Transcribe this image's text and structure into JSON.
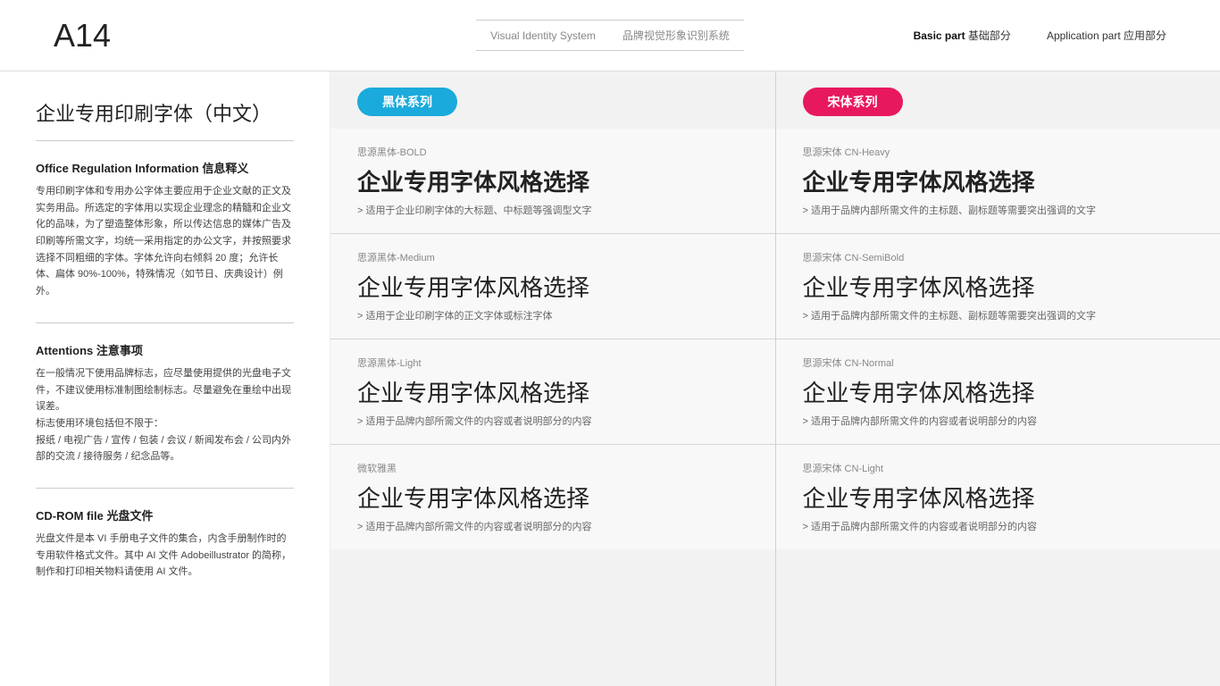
{
  "header": {
    "logo": "A14",
    "title_en": "Visual Identity System",
    "title_cn": "品牌视觉形象识别系统",
    "nav": [
      {
        "label": "Basic part",
        "label_cn": " 基础部分",
        "active": true
      },
      {
        "label": "Application part",
        "label_cn": "  应用部分",
        "active": false
      }
    ]
  },
  "sidebar": {
    "title": "企业专用印刷字体（中文）",
    "sections": [
      {
        "title": "Office Regulation Information 信息释义",
        "body": "专用印刷字体和专用办公字体主要应用于企业文献的正文及实务用品。所选定的字体用以实现企业理念的精髓和企业文化的品味，为了塑造整体形象，所以传达信息的媒体广告及印刷等所需文字，均统一采用指定的办公文字，并按照要求选择不同粗细的字体。字体允许向右倾斜 20 度；允许长体、扁体 90%-100%，特殊情况（如节日、庆典设计）例外。"
      },
      {
        "title": "Attentions 注意事项",
        "body": "在一般情况下使用品牌标志，应尽量使用提供的光盘电子文件，不建议使用标准制图绘制标志。尽量避免在重绘中出现误差。\n标志使用环境包括但不限于：\n报纸 / 电视广告 / 宣传 / 包装 / 会议 / 新闻发布会 / 公司内外部的交流 / 接待服务 / 纪念品等。"
      },
      {
        "title": "CD-ROM file 光盘文件",
        "body": "光盘文件是本 VI 手册电子文件的集合，内含手册制作时的专用软件格式文件。其中 AI 文件 Adobeillustrator 的简称，制作和打印相关物料请使用 AI 文件。"
      }
    ]
  },
  "content": {
    "left": {
      "badge": "黑体系列",
      "badge_color": "blue",
      "fonts": [
        {
          "name": "思源黑体-BOLD",
          "sample": "企业专用字体风格选择",
          "weight": "bold",
          "desc": "> 适用于企业印刷字体的大标题、中标题等强调型文字"
        },
        {
          "name": "思源黑体-Medium",
          "sample": "企业专用字体风格选择",
          "weight": "medium",
          "desc": "> 适用于企业印刷字体的正文字体或标注字体"
        },
        {
          "name": "思源黑体-Light",
          "sample": "企业专用字体风格选择",
          "weight": "light",
          "desc": "> 适用于品牌内部所需文件的内容或者说明部分的内容"
        },
        {
          "name": "微软雅黑",
          "sample": "企业专用字体风格选择",
          "weight": "weihei",
          "desc": "> 适用于品牌内部所需文件的内容或者说明部分的内容"
        }
      ]
    },
    "right": {
      "badge": "宋体系列",
      "badge_color": "pink",
      "fonts": [
        {
          "name": "思源宋体 CN-Heavy",
          "sample": "企业专用字体风格选择",
          "weight": "bold",
          "desc": "> 适用于品牌内部所需文件的主标题、副标题等需要突出强调的文字"
        },
        {
          "name": "思源宋体 CN-SemiBold",
          "sample": "企业专用字体风格选择",
          "weight": "medium",
          "desc": "> 适用于品牌内部所需文件的主标题、副标题等需要突出强调的文字"
        },
        {
          "name": "思源宋体 CN-Normal",
          "sample": "企业专用字体风格选择",
          "weight": "light",
          "desc": "> 适用于品牌内部所需文件的内容或者说明部分的内容"
        },
        {
          "name": "思源宋体 CN-Light",
          "sample": "企业专用字体风格选择",
          "weight": "light",
          "desc": "> 适用于品牌内部所需文件的内容或者说明部分的内容"
        }
      ]
    }
  }
}
